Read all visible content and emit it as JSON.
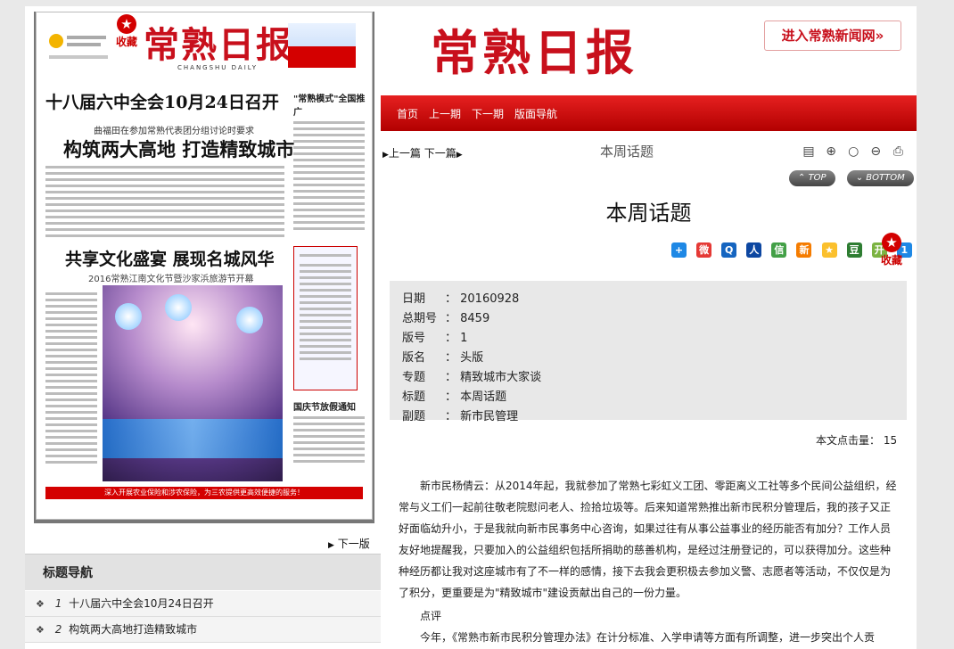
{
  "left": {
    "favorite_label": "收藏",
    "newspaper": {
      "masthead": "常熟日报",
      "masthead_en": "CHANGSHU DAILY",
      "headline": "十八届六中全会10月24日召开",
      "side_head": "\"常熟模式\"全国推广",
      "subline": "曲福田在参加常熟代表团分组讨论时要求",
      "headline2": "构筑两大高地 打造精致城市",
      "headline3": "共享文化盛宴 展现名城风华",
      "subline3": "2016常熟江南文化节暨沙家浜旅游节开幕",
      "notice_title": "国庆节放假通知",
      "footer_band": "深入开展农业保险和涉农保险，为三农提供更高效便捷的服务！"
    },
    "next_page": "下一版",
    "nav_title": "标题导航",
    "nav_items": [
      {
        "num": "1",
        "title": "十八届六中全会10月24日召开"
      },
      {
        "num": "2",
        "title": "构筑两大高地打造精致城市"
      }
    ]
  },
  "right": {
    "logo": "常熟日报",
    "enter_site": "进入常熟新闻网»",
    "menu": [
      "首页",
      "上一期",
      "下一期",
      "版面导航"
    ],
    "prev_article": "上一篇",
    "next_article": "下一篇",
    "section_title": "本周话题",
    "top_btn": "TOP",
    "bottom_btn": "BOTTOM",
    "article_title": "本周话题",
    "favorite_label": "收藏",
    "meta": [
      {
        "k": "日期",
        "v": "20160928"
      },
      {
        "k": "总期号",
        "v": "8459"
      },
      {
        "k": "版号",
        "v": "1"
      },
      {
        "k": "版名",
        "v": "头版"
      },
      {
        "k": "专题",
        "v": "精致城市大家谈"
      },
      {
        "k": "标题",
        "v": "本周话题"
      },
      {
        "k": "副题",
        "v": "新市民管理"
      }
    ],
    "clicks_label": "本文点击量：",
    "clicks_value": "15",
    "paragraph1": "新市民杨倩云：从2014年起，我就参加了常熟七彩虹义工团、零距离义工社等多个民间公益组织，经常与义工们一起前往敬老院慰问老人、捡拾垃圾等。后来知道常熟推出新市民积分管理后，我的孩子又正好面临幼升小，于是我就向新市民事务中心咨询，如果过往有从事公益事业的经历能否有加分？工作人员友好地提醒我，只要加入的公益组织包括所捐助的慈善机构，是经过注册登记的，可以获得加分。这些种种经历都让我对这座城市有了不一样的感情，接下去我会更积极去参加义警、志愿者等活动，不仅仅是为了积分，更重要是为\"精致城市\"建设贡献出自己的一份力量。",
    "comment_label": "点评",
    "paragraph2": "今年，《常熟市新市民积分管理办法》在计分标准、入学申请等方面有所调整，进一步突出个人贡"
  },
  "colors": {
    "brand_red": "#c8101c",
    "bar_red": "#d40000"
  }
}
